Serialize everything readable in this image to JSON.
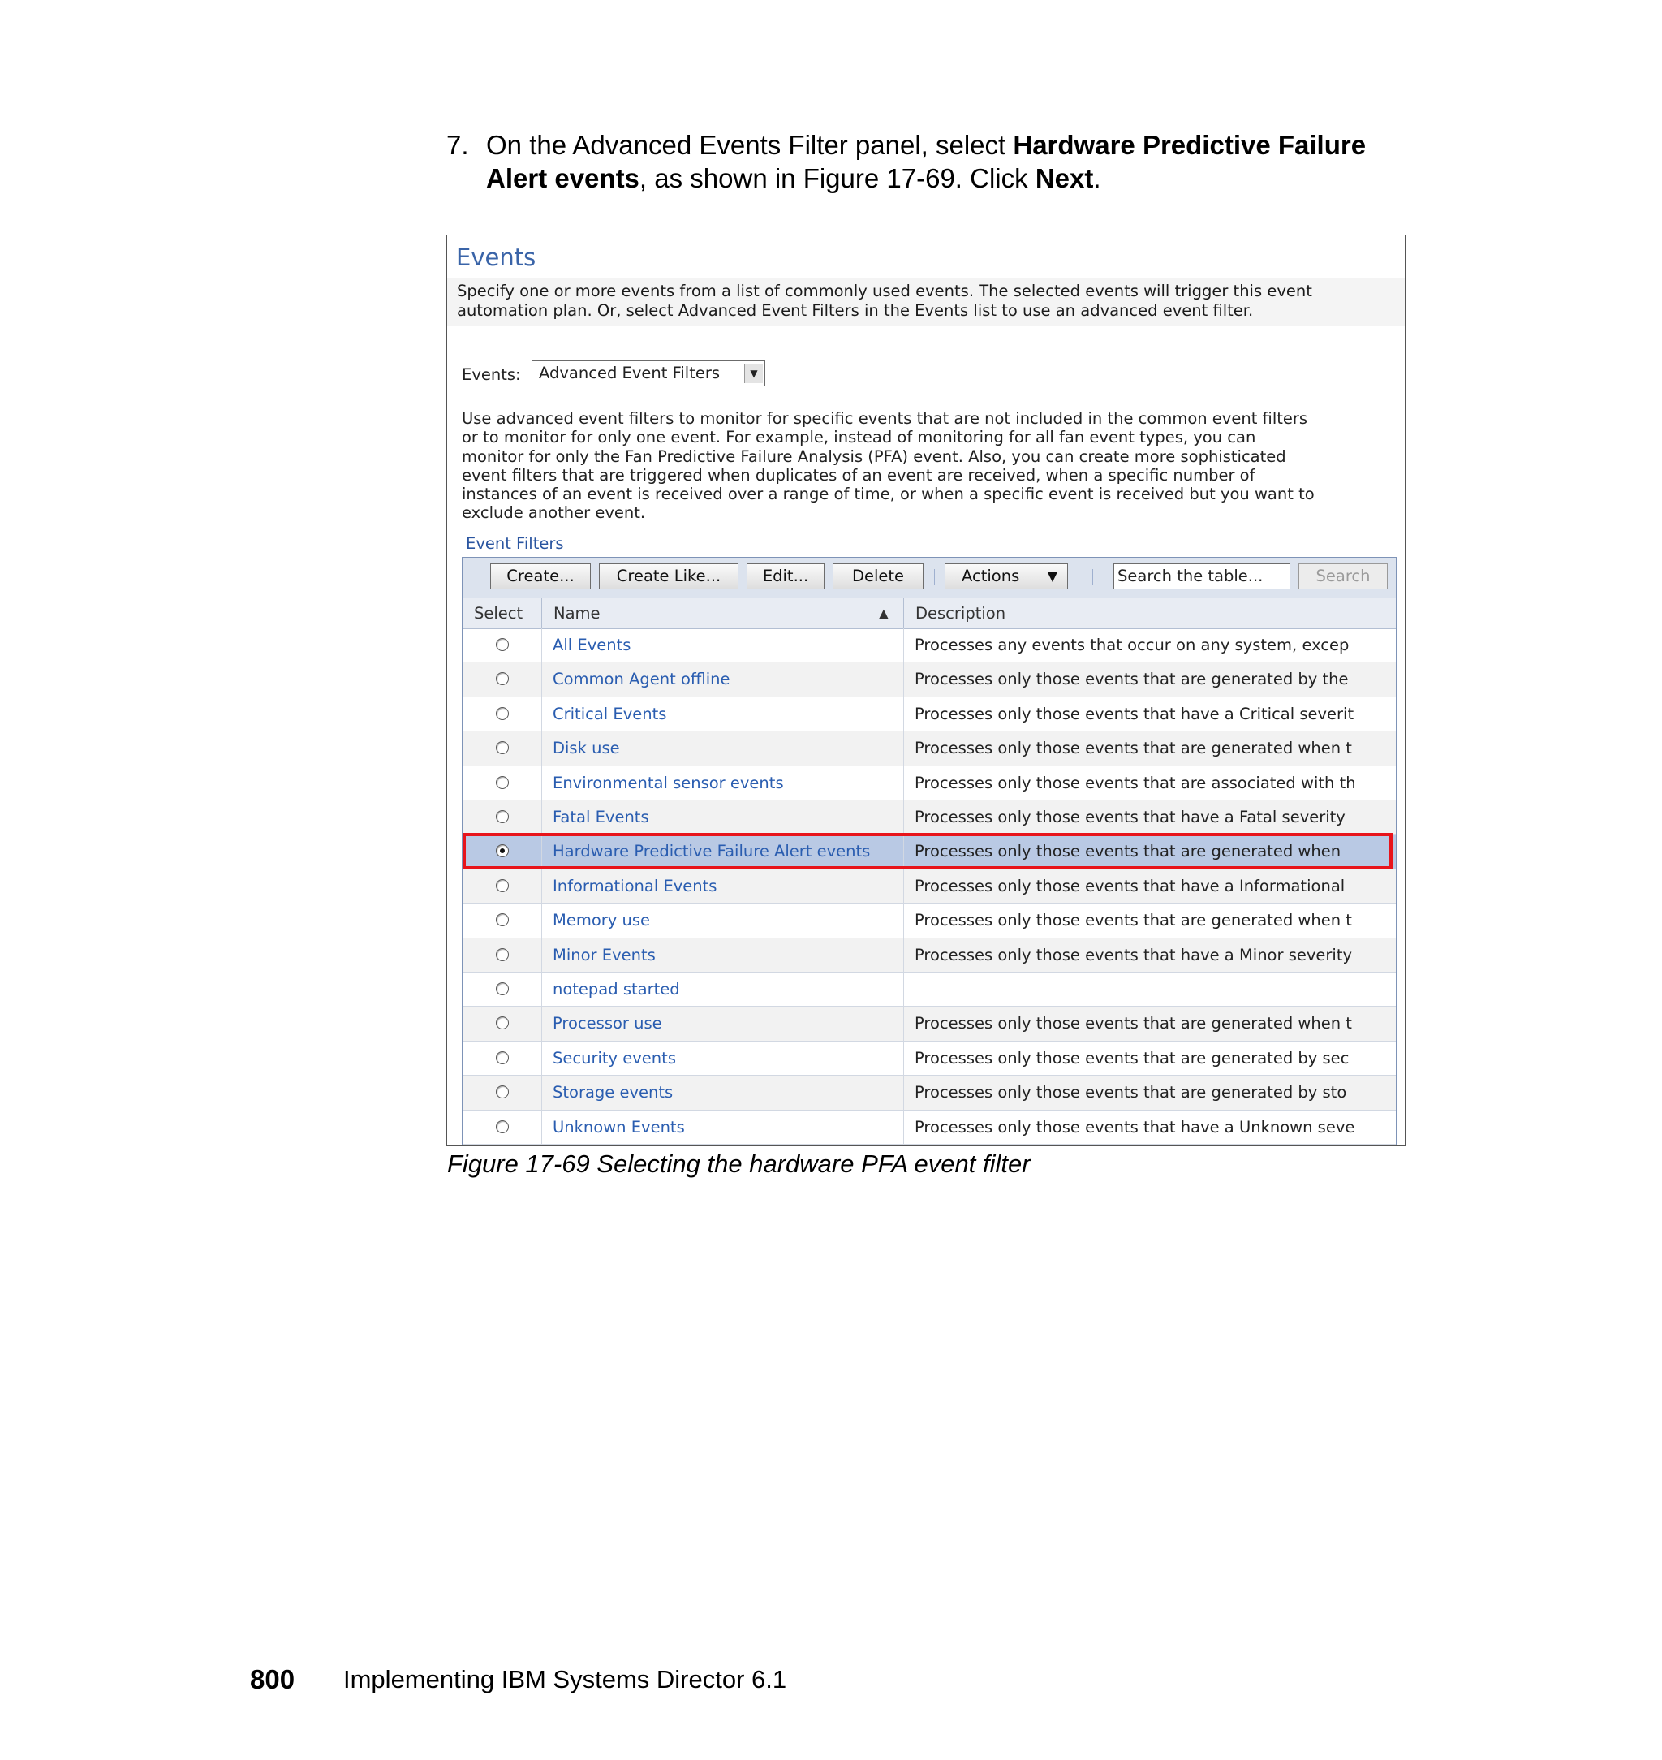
{
  "step": {
    "number": "7.",
    "text_1": "On the Advanced Events Filter panel, select ",
    "bold_1": "Hardware Predictive Failure Alert events",
    "text_2": ", as shown in Figure 17-69. Click ",
    "bold_2": "Next",
    "text_3": "."
  },
  "panel": {
    "title": "Events",
    "description_lines": [
      "Specify one or more events from a list of commonly used events. The selected events will trigger this event",
      "automation plan. Or, select Advanced Event Filters in the Events list to use an advanced event filter."
    ],
    "events_label": "Events:",
    "events_selected": "Advanced Event Filters",
    "advanced_lines": [
      "Use advanced event filters to monitor for specific events that are not included in the common event filters",
      "or to monitor for only one event. For example, instead of monitoring for all fan event types, you can",
      "monitor for only the Fan Predictive Failure Analysis (PFA) event. Also, you can create more sophisticated",
      "event filters that are triggered when duplicates of an event are received, when a specific number of",
      "instances of an event is received over a range of time, or when a specific event is received but you want to",
      "exclude another event."
    ],
    "filters_label": "Event Filters"
  },
  "toolbar": {
    "create": "Create...",
    "create_like": "Create Like...",
    "edit": "Edit...",
    "delete": "Delete",
    "actions": "Actions",
    "search_value": "Search the table...",
    "search_button": "Search"
  },
  "table": {
    "headers": {
      "select": "Select",
      "name": "Name",
      "description": "Description"
    },
    "rows": [
      {
        "name": "All Events",
        "description": "Processes any events that occur on any system, excep",
        "selected": false
      },
      {
        "name": "Common Agent offline",
        "description": "Processes only those events that are generated by the",
        "selected": false
      },
      {
        "name": "Critical Events",
        "description": "Processes only those events that have a Critical severit",
        "selected": false
      },
      {
        "name": "Disk use",
        "description": "Processes only those events that are generated when t",
        "selected": false
      },
      {
        "name": "Environmental sensor events",
        "description": "Processes only those events that are associated with th",
        "selected": false
      },
      {
        "name": "Fatal Events",
        "description": "Processes only those events that have a Fatal severity",
        "selected": false
      },
      {
        "name": "Hardware Predictive Failure Alert events",
        "description": "Processes only those events that are generated when",
        "selected": true
      },
      {
        "name": "Informational Events",
        "description": "Processes only those events that have a Informational",
        "selected": false
      },
      {
        "name": "Memory use",
        "description": "Processes only those events that are generated when t",
        "selected": false
      },
      {
        "name": "Minor Events",
        "description": "Processes only those events that have a Minor severity",
        "selected": false
      },
      {
        "name": "notepad started",
        "description": "",
        "selected": false
      },
      {
        "name": "Processor use",
        "description": "Processes only those events that are generated when t",
        "selected": false
      },
      {
        "name": "Security events",
        "description": "Processes only those events that are generated by sec",
        "selected": false
      },
      {
        "name": "Storage events",
        "description": "Processes only those events that are generated by sto",
        "selected": false
      },
      {
        "name": "Unknown Events",
        "description": "Processes only those events that have a Unknown seve",
        "selected": false
      }
    ]
  },
  "caption": "Figure 17-69   Selecting the hardware PFA event filter",
  "footer": {
    "page_number": "800",
    "book_title": "Implementing IBM Systems Director 6.1"
  },
  "colors": {
    "highlight": "#e8141b",
    "link": "#2a5db0",
    "selected_row": "#b9c9e4"
  },
  "icons": {
    "dropdown": "chevron-down-icon",
    "actions": "triangle-down-icon",
    "sort": "sort-icon"
  }
}
